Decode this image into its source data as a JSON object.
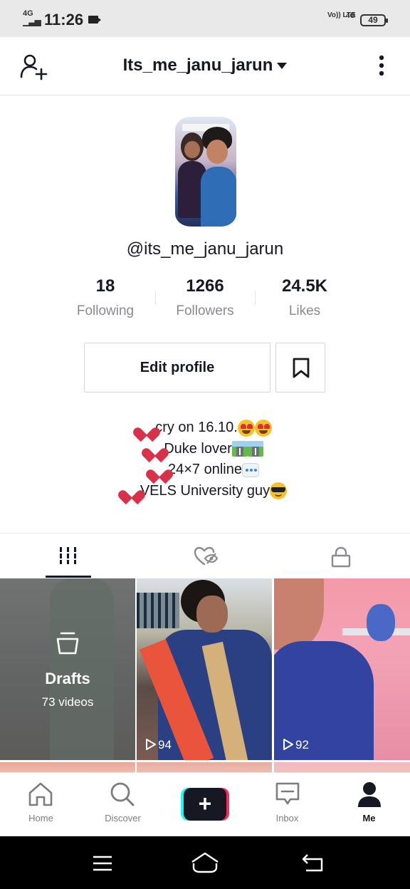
{
  "status_bar": {
    "network": "4G",
    "time": "11:26",
    "volte": "Vo)) LTE",
    "network2": "4G",
    "battery": "49"
  },
  "header": {
    "title": "Its_me_janu_jarun",
    "icons": [
      "add-user-icon",
      "caret-down-icon",
      "more-vertical-icon"
    ]
  },
  "profile": {
    "handle": "@its_me_janu_jarun",
    "stats": [
      {
        "value": "18",
        "label": "Following"
      },
      {
        "value": "1266",
        "label": "Followers"
      },
      {
        "value": "24.5K",
        "label": "Likes"
      }
    ],
    "edit_button": "Edit profile",
    "bio": [
      {
        "text": "cry on 16.10.",
        "lead": "heart",
        "trail": [
          "love",
          "love"
        ]
      },
      {
        "text": "Duke lover",
        "lead": "heart",
        "trail": [
          "road",
          "road"
        ]
      },
      {
        "text": "24×7 online",
        "lead": "heart",
        "trail": [
          "speech"
        ]
      },
      {
        "text": "VELS University guy",
        "lead": "heart",
        "trail": [
          "cool"
        ]
      }
    ]
  },
  "tabs": [
    {
      "name": "videos",
      "icon": "grid-icon",
      "active": true
    },
    {
      "name": "liked",
      "icon": "liked-hidden-icon",
      "active": false
    },
    {
      "name": "private",
      "icon": "lock-icon",
      "active": false
    }
  ],
  "grid": {
    "drafts": {
      "title": "Drafts",
      "count": "73 videos"
    },
    "videos": [
      {
        "views": "94"
      },
      {
        "views": "92"
      }
    ]
  },
  "bottom_nav": [
    {
      "label": "Home",
      "icon": "home-icon"
    },
    {
      "label": "Discover",
      "icon": "search-icon"
    },
    {
      "label": "",
      "icon": "create-plus-icon"
    },
    {
      "label": "Inbox",
      "icon": "inbox-icon"
    },
    {
      "label": "Me",
      "icon": "profile-icon",
      "active": true
    }
  ],
  "colors": {
    "text": "#161823",
    "muted": "#8a8b91",
    "cyan": "#25f4ee",
    "red": "#fe2c55"
  }
}
